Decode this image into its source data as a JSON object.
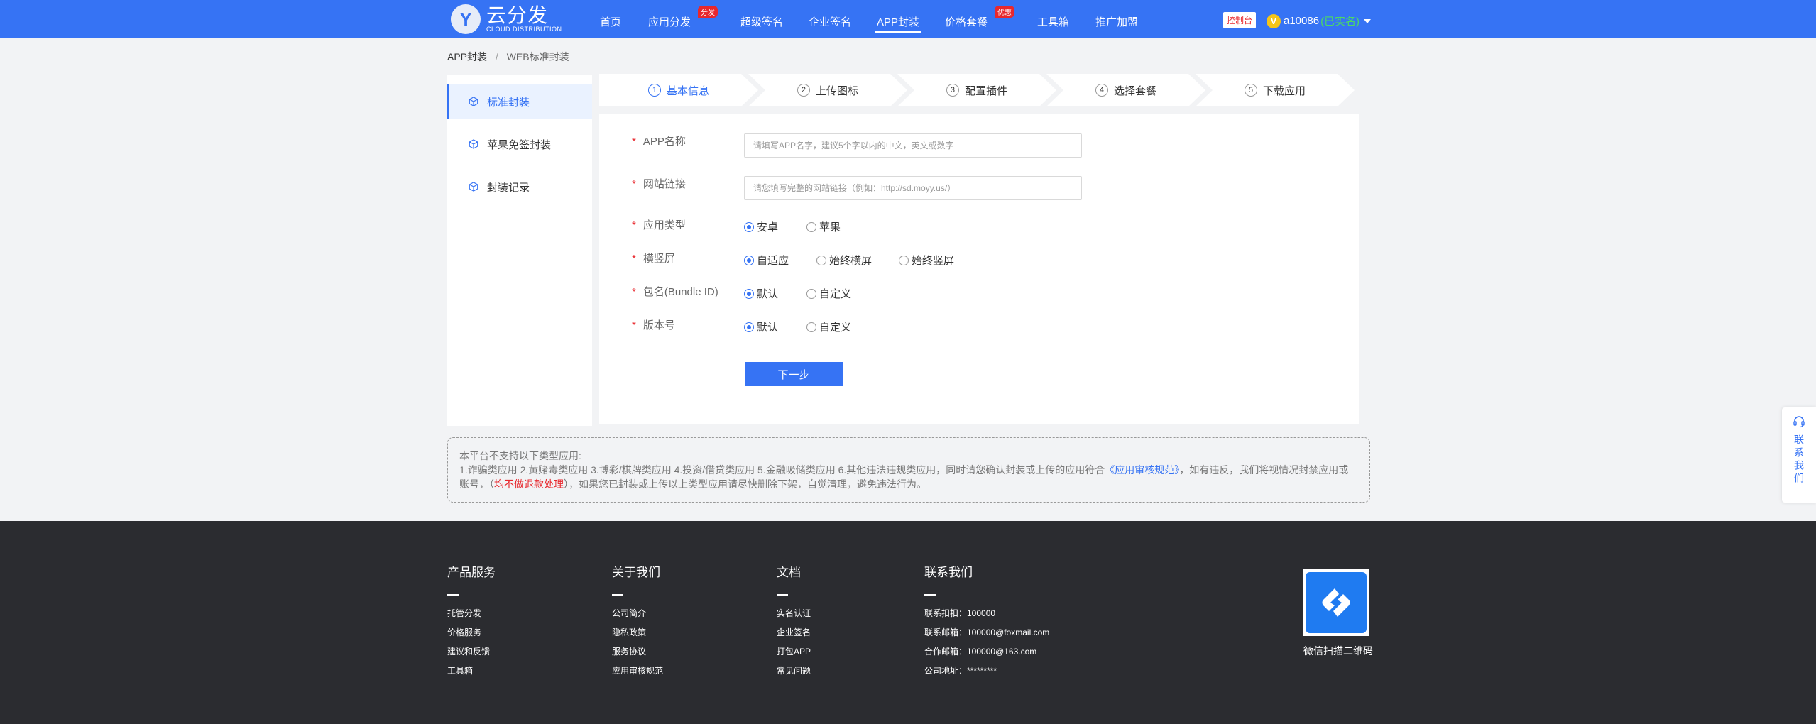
{
  "header": {
    "logo_letter": "Y",
    "logo_cn": "云分发",
    "logo_en": "CLOUD DISTRIBUTION",
    "nav": [
      {
        "label": "首页",
        "badge": ""
      },
      {
        "label": "应用分发",
        "badge": "分发"
      },
      {
        "label": "超级签名",
        "badge": ""
      },
      {
        "label": "企业签名",
        "badge": ""
      },
      {
        "label": "APP封装",
        "badge": ""
      },
      {
        "label": "价格套餐",
        "badge": "优惠"
      },
      {
        "label": "工具箱",
        "badge": ""
      },
      {
        "label": "推广加盟",
        "badge": ""
      }
    ],
    "console_label": "控制台",
    "user_v": "V",
    "username": "a10086",
    "verified": "(已实名)"
  },
  "breadcrumb": {
    "root": "APP封装",
    "sep": "/",
    "current": "WEB标准封装"
  },
  "sidemenu": {
    "items": [
      {
        "label": "标准封装"
      },
      {
        "label": "苹果免签封装"
      },
      {
        "label": "封装记录"
      }
    ]
  },
  "steps": [
    {
      "num": "1",
      "label": "基本信息"
    },
    {
      "num": "2",
      "label": "上传图标"
    },
    {
      "num": "3",
      "label": "配置插件"
    },
    {
      "num": "4",
      "label": "选择套餐"
    },
    {
      "num": "5",
      "label": "下载应用"
    }
  ],
  "form": {
    "required_mark": "*",
    "app_name": {
      "label": "APP名称",
      "placeholder": "请填写APP名字，建议5个字以内的中文，英文或数字"
    },
    "website": {
      "label": "网站链接",
      "placeholder": "请您填写完整的网站链接（例如：http://sd.moyy.us/）"
    },
    "app_type": {
      "label": "应用类型",
      "options": [
        "安卓",
        "苹果"
      ]
    },
    "orientation": {
      "label": "横竖屏",
      "options": [
        "自适应",
        "始终横屏",
        "始终竖屏"
      ]
    },
    "bundle_id": {
      "label": "包名(Bundle ID)",
      "options": [
        "默认",
        "自定义"
      ]
    },
    "version": {
      "label": "版本号",
      "options": [
        "默认",
        "自定义"
      ]
    },
    "next_label": "下一步"
  },
  "notice": {
    "line1": "本平台不支持以下类型应用:",
    "line2_a": "1.诈骗类应用 2.黄赌毒类应用 3.博彩/棋牌类应用 4.投资/借贷类应用 5.金融吸储类应用 6.其他违法违规类应用，同时请您确认封装或上传的应用符合",
    "line2_link": "《应用审核规范》",
    "line2_b": "，如有违反，我们将视情况封禁应用或",
    "line3_a": "账号，（",
    "line3_red": "均不做退款处理",
    "line3_b": "），如果您已封装或上传以上类型应用请尽快删除下架，自觉清理，避免违法行为。"
  },
  "contact_float": "联系我们",
  "footer": {
    "columns": [
      {
        "title": "产品服务",
        "links": [
          "托管分发",
          "价格服务",
          "建议和反馈",
          "工具箱"
        ]
      },
      {
        "title": "关于我们",
        "links": [
          "公司简介",
          "隐私政策",
          "服务协议",
          "应用审核规范"
        ]
      },
      {
        "title": "文档",
        "links": [
          "实名认证",
          "企业签名",
          "打包APP",
          "常见问题"
        ]
      },
      {
        "title": "联系我们",
        "links": [
          "联系扣扣：100000",
          "联系邮箱：100000@foxmail.com",
          "合作邮箱：100000@163.com",
          "公司地址：*********"
        ]
      }
    ],
    "qr_label": "微信扫描二维码"
  },
  "colors": {
    "brand": "#3673f4",
    "footer_bg": "#2b2c30",
    "danger": "#e8272d"
  }
}
